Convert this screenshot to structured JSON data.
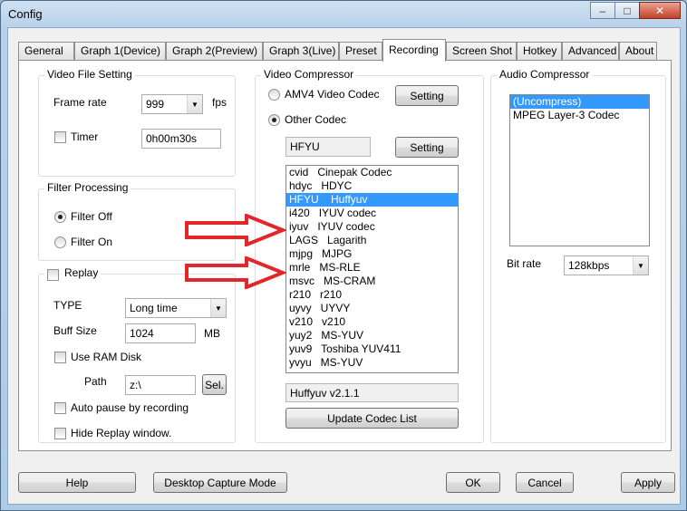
{
  "window": {
    "title": "Config",
    "minimize": "–",
    "maximize": "□",
    "close": "✕"
  },
  "tabs": [
    "General",
    "Graph 1(Device)",
    "Graph 2(Preview)",
    "Graph 3(Live)",
    "Preset",
    "Recording",
    "Screen Shot",
    "Hotkey",
    "Advanced",
    "About"
  ],
  "active_tab": "Recording",
  "video_file": {
    "title": "Video File Setting",
    "frame_rate_label": "Frame rate",
    "frame_rate_value": "999",
    "fps": "fps",
    "timer_label": "Timer",
    "timer_value": "0h00m30s"
  },
  "filter": {
    "title": "Filter Processing",
    "off_label": "Filter Off",
    "on_label": "Filter On"
  },
  "replay": {
    "title": "Replay",
    "type_label": "TYPE",
    "type_value": "Long time",
    "buff_label": "Buff Size",
    "buff_value": "1024",
    "buff_unit": "MB",
    "ram_disk_label": "Use RAM Disk",
    "path_label": "Path",
    "path_value": "z:\\",
    "sel_label": "Sel.",
    "auto_pause_label": "Auto pause by recording",
    "hide_label": "Hide Replay window."
  },
  "video_compressor": {
    "title": "Video Compressor",
    "amv4_label": "AMV4 Video Codec",
    "other_label": "Other Codec",
    "setting_label": "Setting",
    "codec_value": "HFYU",
    "codecs": [
      "cvid   Cinepak Codec",
      "hdyc   HDYC",
      "HFYU    Huffyuv",
      "i420   IYUV codec",
      "iyuv   IYUV codec",
      "LAGS   Lagarith",
      "mjpg   MJPG",
      "mrle   MS-RLE",
      "msvc   MS-CRAM",
      "r210   r210",
      "uyvy   UYVY",
      "v210   v210",
      "yuy2   MS-YUV",
      "yuv9   Toshiba YUV411",
      "yvyu   MS-YUV"
    ],
    "selected_codec_index": 2,
    "codec_version": "Huffyuv v2.1.1",
    "update_label": "Update Codec List"
  },
  "audio_compressor": {
    "title": "Audio Compressor",
    "codecs": [
      "(Uncompress)",
      "MPEG Layer-3 Codec"
    ],
    "selected_index": 0,
    "bitrate_label": "Bit rate",
    "bitrate_value": "128kbps"
  },
  "bottom": {
    "help": "Help",
    "desktop": "Desktop Capture Mode",
    "ok": "OK",
    "cancel": "Cancel",
    "apply": "Apply"
  },
  "colors": {
    "annotation_arrow": "#e3262b",
    "selection": "#3399ff"
  }
}
